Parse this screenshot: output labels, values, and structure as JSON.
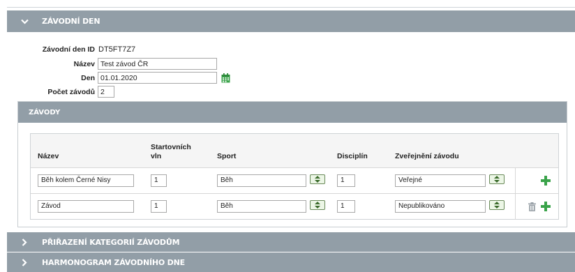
{
  "race_day_section": {
    "title": "ZÁVODNÍ DEN",
    "fields": {
      "id_label": "Závodní den ID",
      "id_value": "DT5FT7Z7",
      "name_label": "Název",
      "name_value": "Test závod ČR",
      "day_label": "Den",
      "day_value": "01.01.2020",
      "count_label": "Počet závodů",
      "count_value": "2"
    },
    "icons": {
      "calendar": "calendar-icon",
      "collapse": "chevron-down-icon"
    }
  },
  "races_section": {
    "title": "ZÁVODY",
    "columns": {
      "name": "Název",
      "waves_line1": "Startovních",
      "waves_line2": "vln",
      "sport": "Sport",
      "discipline": "Disciplín",
      "publish": "Zveřejnění závodu"
    },
    "rows": [
      {
        "name": "Běh kolem Černé Nisy",
        "waves": "1",
        "sport": "Běh",
        "discipline": "1",
        "publish": "Veřejné"
      },
      {
        "name": "Závod",
        "waves": "1",
        "sport": "Běh",
        "discipline": "1",
        "publish": "Nepublikováno"
      }
    ],
    "colors": {
      "accent_green": "#3aa34a",
      "header_bg": "#929ea7"
    }
  },
  "category_section": {
    "title": "PŘIŘAZENÍ KATEGORIÍ ZÁVODŮM"
  },
  "schedule_section": {
    "title": "HARMONOGRAM ZÁVODNÍHO DNE"
  }
}
